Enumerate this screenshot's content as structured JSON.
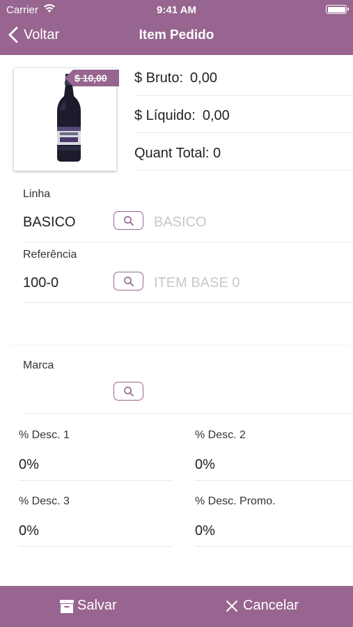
{
  "status_bar": {
    "carrier": "Carrier",
    "time": "9:41 AM"
  },
  "nav": {
    "back_label": "Voltar",
    "title": "Item Pedido"
  },
  "product": {
    "price_tag": "$ 10,00",
    "image": "bottle"
  },
  "summary": {
    "gross_label": "$ Bruto:",
    "gross_value": "0,00",
    "net_label": "$ Líquido:",
    "net_value": "0,00",
    "qty_label": "Quant Total:",
    "qty_value": "0"
  },
  "form": {
    "linha": {
      "label": "Linha",
      "value": "BASICO",
      "placeholder": "BASICO"
    },
    "referencia": {
      "label": "Referência",
      "value": "100-0",
      "placeholder": "ITEM BASE 0"
    },
    "marca": {
      "label": "Marca",
      "value": ""
    }
  },
  "discounts": {
    "desc1": {
      "label": "% Desc. 1",
      "value": "0%"
    },
    "desc2": {
      "label": "% Desc. 2",
      "value": "0%"
    },
    "desc3": {
      "label": "% Desc. 3",
      "value": "0%"
    },
    "promo": {
      "label": "% Desc. Promo.",
      "value": "0%"
    }
  },
  "toolbar": {
    "save_label": "Salvar",
    "cancel_label": "Cancelar"
  },
  "colors": {
    "accent": "#97658f",
    "divider": "#e8e8e8",
    "placeholder": "#c8c8c8"
  },
  "icons": {
    "back": "chevron-left-icon",
    "search": "search-icon",
    "save": "archive-icon",
    "cancel": "close-icon",
    "wifi": "wifi-icon",
    "battery": "battery-icon"
  }
}
